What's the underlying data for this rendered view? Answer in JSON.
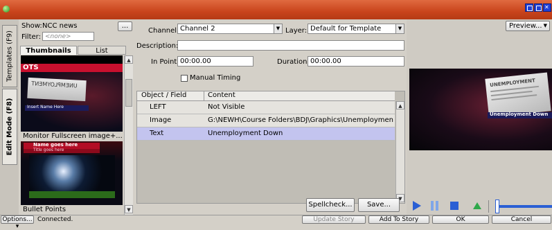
{
  "window": {
    "buttons": [
      "minimize",
      "maximize",
      "close"
    ]
  },
  "side_tabs": {
    "templates": "Templates (F9)",
    "edit_mode": "Edit Mode (F8)"
  },
  "left": {
    "show_label": "Show:",
    "show_value": "NCC news",
    "show_button": "...",
    "filter_label": "Filter:",
    "filter_placeholder": "<none>",
    "tabs": [
      "Thumbnails",
      "List"
    ],
    "thumbs": [
      {
        "label": "OTS",
        "caption": "",
        "inner_title": "UNEMPLOYMENT",
        "inner_lower": "Insert Name Here"
      },
      {
        "label": "",
        "caption": "Monitor Fullscreen image+...",
        "inner_title": "Name goes here",
        "inner_lower": "Title goes here"
      },
      {
        "label": "",
        "caption": "Bullet Points"
      }
    ],
    "mirrored_text": "UNEMPLOYMENT"
  },
  "form": {
    "channel_label": "Channel:",
    "channel_value": "Channel 2",
    "layer_label": "Layer:",
    "layer_value": "Default for Template",
    "description_label": "Description:",
    "description_value": "",
    "inpoint_label": "In Point:",
    "inpoint_value": "00:00.00",
    "duration_label": "Duration:",
    "duration_value": "00:00.00",
    "manual_timing_label": "Manual Timing",
    "manual_timing_checked": false
  },
  "grid": {
    "headers": [
      "Object / Field",
      "Content"
    ],
    "rows": [
      {
        "field": "LEFT",
        "content": "Not Visible"
      },
      {
        "field": "Image",
        "content": "G:\\NEWH\\Course Folders\\BDJ\\Graphics\\Unemployment.jpg"
      },
      {
        "field": "Text",
        "content": "Unemployment Down",
        "selected": true
      }
    ]
  },
  "buttons": {
    "spellcheck": "Spellcheck...",
    "save": "Save...",
    "update_story": "Update Story",
    "add_to_story": "Add To Story",
    "ok": "OK",
    "cancel": "Cancel"
  },
  "preview": {
    "button": "Preview...",
    "lower_third": "Unemployment Down",
    "paper_headline": "UNEMPLOYMENT"
  },
  "status": {
    "options": "Options...",
    "connection": "Connected."
  },
  "colors": {
    "titlebar": "#c9441c",
    "selection": "#c3c4ef",
    "play": "#2a5fd4",
    "accent_green": "#2fa84a"
  }
}
